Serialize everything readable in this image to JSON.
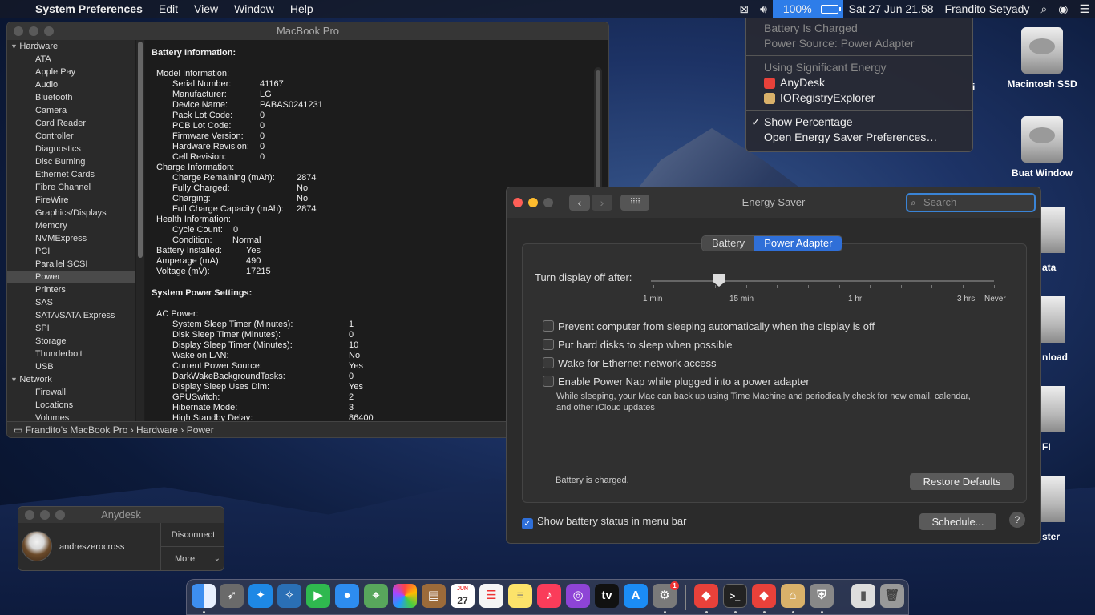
{
  "menubar": {
    "app_name": "System Preferences",
    "menus": [
      "Edit",
      "View",
      "Window",
      "Help"
    ],
    "battery_percent": "100%",
    "datetime": "Sat 27 Jun  21.58",
    "user": "Frandito Setyady"
  },
  "battery_menu": {
    "status": "Battery Is Charged",
    "power_source": "Power Source: Power Adapter",
    "energy_header": "Using Significant Energy",
    "apps": [
      "AnyDesk",
      "IORegistryExplorer"
    ],
    "show_percentage": "Show Percentage",
    "open_prefs": "Open Energy Saver Preferences…"
  },
  "desktop_icons": [
    {
      "label": "Macintosh SSD"
    },
    {
      "label": "Buat Window"
    }
  ],
  "desktop_partial_labels": [
    "i",
    "ata",
    "nload",
    "FI",
    "ster"
  ],
  "sysinfo": {
    "title": "MacBook Pro",
    "sidebar": [
      {
        "type": "cat",
        "label": "Hardware"
      },
      {
        "type": "sub",
        "label": "ATA"
      },
      {
        "type": "sub",
        "label": "Apple Pay"
      },
      {
        "type": "sub",
        "label": "Audio"
      },
      {
        "type": "sub",
        "label": "Bluetooth"
      },
      {
        "type": "sub",
        "label": "Camera"
      },
      {
        "type": "sub",
        "label": "Card Reader"
      },
      {
        "type": "sub",
        "label": "Controller"
      },
      {
        "type": "sub",
        "label": "Diagnostics"
      },
      {
        "type": "sub",
        "label": "Disc Burning"
      },
      {
        "type": "sub",
        "label": "Ethernet Cards"
      },
      {
        "type": "sub",
        "label": "Fibre Channel"
      },
      {
        "type": "sub",
        "label": "FireWire"
      },
      {
        "type": "sub",
        "label": "Graphics/Displays"
      },
      {
        "type": "sub",
        "label": "Memory"
      },
      {
        "type": "sub",
        "label": "NVMExpress"
      },
      {
        "type": "sub",
        "label": "PCI"
      },
      {
        "type": "sub",
        "label": "Parallel SCSI"
      },
      {
        "type": "sub",
        "label": "Power",
        "selected": true
      },
      {
        "type": "sub",
        "label": "Printers"
      },
      {
        "type": "sub",
        "label": "SAS"
      },
      {
        "type": "sub",
        "label": "SATA/SATA Express"
      },
      {
        "type": "sub",
        "label": "SPI"
      },
      {
        "type": "sub",
        "label": "Storage"
      },
      {
        "type": "sub",
        "label": "Thunderbolt"
      },
      {
        "type": "sub",
        "label": "USB"
      },
      {
        "type": "cat",
        "label": "Network"
      },
      {
        "type": "sub",
        "label": "Firewall"
      },
      {
        "type": "sub",
        "label": "Locations"
      },
      {
        "type": "sub",
        "label": "Volumes"
      }
    ],
    "battery_heading": "Battery Information:",
    "battery_rows": [
      {
        "indent": 1,
        "k": "Model Information:",
        "v": ""
      },
      {
        "indent": 2,
        "k": "Serial Number:",
        "v": "41167",
        "vcol": 1
      },
      {
        "indent": 2,
        "k": "Manufacturer:",
        "v": "LG",
        "vcol": 1
      },
      {
        "indent": 2,
        "k": "Device Name:",
        "v": "PABAS0241231",
        "vcol": 1
      },
      {
        "indent": 2,
        "k": "Pack Lot Code:",
        "v": "0",
        "vcol": 1
      },
      {
        "indent": 2,
        "k": "PCB Lot Code:",
        "v": "0",
        "vcol": 1
      },
      {
        "indent": 2,
        "k": "Firmware Version:",
        "v": "0",
        "vcol": 1
      },
      {
        "indent": 2,
        "k": "Hardware Revision:",
        "v": "0",
        "vcol": 1
      },
      {
        "indent": 2,
        "k": "Cell Revision:",
        "v": "0",
        "vcol": 1
      },
      {
        "indent": 1,
        "k": "Charge Information:",
        "v": ""
      },
      {
        "indent": 2,
        "k": "Charge Remaining (mAh):",
        "v": "2874",
        "vcol": 2
      },
      {
        "indent": 2,
        "k": "Fully Charged:",
        "v": "No",
        "vcol": 2
      },
      {
        "indent": 2,
        "k": "Charging:",
        "v": "No",
        "vcol": 2
      },
      {
        "indent": 2,
        "k": "Full Charge Capacity (mAh):",
        "v": "2874",
        "vcol": 2
      },
      {
        "indent": 1,
        "k": "Health Information:",
        "v": ""
      },
      {
        "indent": 2,
        "k": "Cycle Count:",
        "v": "0",
        "vcol": 3
      },
      {
        "indent": 2,
        "k": "Condition:",
        "v": "Normal",
        "vcol": 4
      },
      {
        "indent": 1,
        "k": "Battery Installed:",
        "v": "Yes",
        "vcol": 5
      },
      {
        "indent": 1,
        "k": "Amperage (mA):",
        "v": "490",
        "vcol": 5
      },
      {
        "indent": 1,
        "k": "Voltage (mV):",
        "v": "17215",
        "vcol": 5
      }
    ],
    "power_heading": "System Power Settings:",
    "power_rows": [
      {
        "indent": 1,
        "k": "AC Power:",
        "v": ""
      },
      {
        "indent": 2,
        "k": "System Sleep Timer (Minutes):",
        "v": "1"
      },
      {
        "indent": 2,
        "k": "Disk Sleep Timer (Minutes):",
        "v": "0"
      },
      {
        "indent": 2,
        "k": "Display Sleep Timer (Minutes):",
        "v": "10"
      },
      {
        "indent": 2,
        "k": "Wake on LAN:",
        "v": "No"
      },
      {
        "indent": 2,
        "k": "Current Power Source:",
        "v": "Yes"
      },
      {
        "indent": 2,
        "k": "DarkWakeBackgroundTasks:",
        "v": "0"
      },
      {
        "indent": 2,
        "k": "Display Sleep Uses Dim:",
        "v": "Yes"
      },
      {
        "indent": 2,
        "k": "GPUSwitch:",
        "v": "2"
      },
      {
        "indent": 2,
        "k": "Hibernate Mode:",
        "v": "3"
      },
      {
        "indent": 2,
        "k": "High Standby Delay:",
        "v": "86400"
      }
    ],
    "statusbar": "Frandito's MacBook Pro › Hardware › Power"
  },
  "energy": {
    "title": "Energy Saver",
    "search_placeholder": "Search",
    "tabs": [
      "Battery",
      "Power Adapter"
    ],
    "active_tab": "Power Adapter",
    "slider_label": "Turn display off after:",
    "slider_ticks": [
      "1 min",
      "15 min",
      "1 hr",
      "3 hrs",
      "Never"
    ],
    "slider_value": "15 min",
    "options": [
      {
        "label": "Prevent computer from sleeping automatically when the display is off",
        "checked": false
      },
      {
        "label": "Put hard disks to sleep when possible",
        "checked": false
      },
      {
        "label": "Wake for Ethernet network access",
        "checked": false
      },
      {
        "label": "Enable Power Nap while plugged into a power adapter",
        "checked": false
      }
    ],
    "power_nap_desc": "While sleeping, your Mac can back up using Time Machine and periodically check for new email, calendar, and other iCloud updates",
    "battery_status": "Battery is charged.",
    "restore_defaults": "Restore Defaults",
    "show_battery": "Show battery status in menu bar",
    "show_battery_checked": true,
    "schedule": "Schedule...",
    "help": "?"
  },
  "anydesk": {
    "title": "Anydesk",
    "user": "andreszerocross",
    "disconnect": "Disconnect",
    "more": "More"
  },
  "dock": {
    "calendar_month": "JUN",
    "calendar_day": "27",
    "prefs_badge": "1"
  }
}
